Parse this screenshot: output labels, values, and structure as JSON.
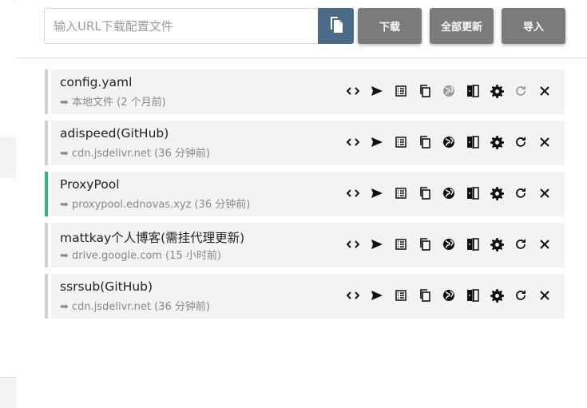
{
  "search": {
    "placeholder": "输入URL下载配置文件"
  },
  "toolbar": {
    "download_label": "下载",
    "update_all_label": "全部更新",
    "import_label": "导入"
  },
  "profiles": [
    {
      "name": "config.yaml",
      "source": "➥ 本地文件 (2 个月前)",
      "active": false
    },
    {
      "name": "adispeed(GitHub)",
      "source": "➥ cdn.jsdelivr.net (36 分钟前)",
      "active": false
    },
    {
      "name": "ProxyPool",
      "source": "➥ proxypool.ednovas.xyz (36 分钟前)",
      "active": true
    },
    {
      "name": "mattkay个人博客(需挂代理更新)",
      "source": "➥ drive.google.com (15 小时前)",
      "active": false
    },
    {
      "name": "ssrsub(GitHub)",
      "source": "➥ cdn.jsdelivr.net (36 分钟前)",
      "active": false
    }
  ],
  "colors": {
    "active_indicator": "#35b57c",
    "paste_button": "#4a6a86",
    "toolbar_button": "#7b7b7b"
  },
  "row_icons": [
    "code-icon",
    "send-icon",
    "list-icon",
    "copy-icon",
    "globe-icon",
    "compare-icon",
    "gear-icon",
    "refresh-icon",
    "close-icon"
  ]
}
